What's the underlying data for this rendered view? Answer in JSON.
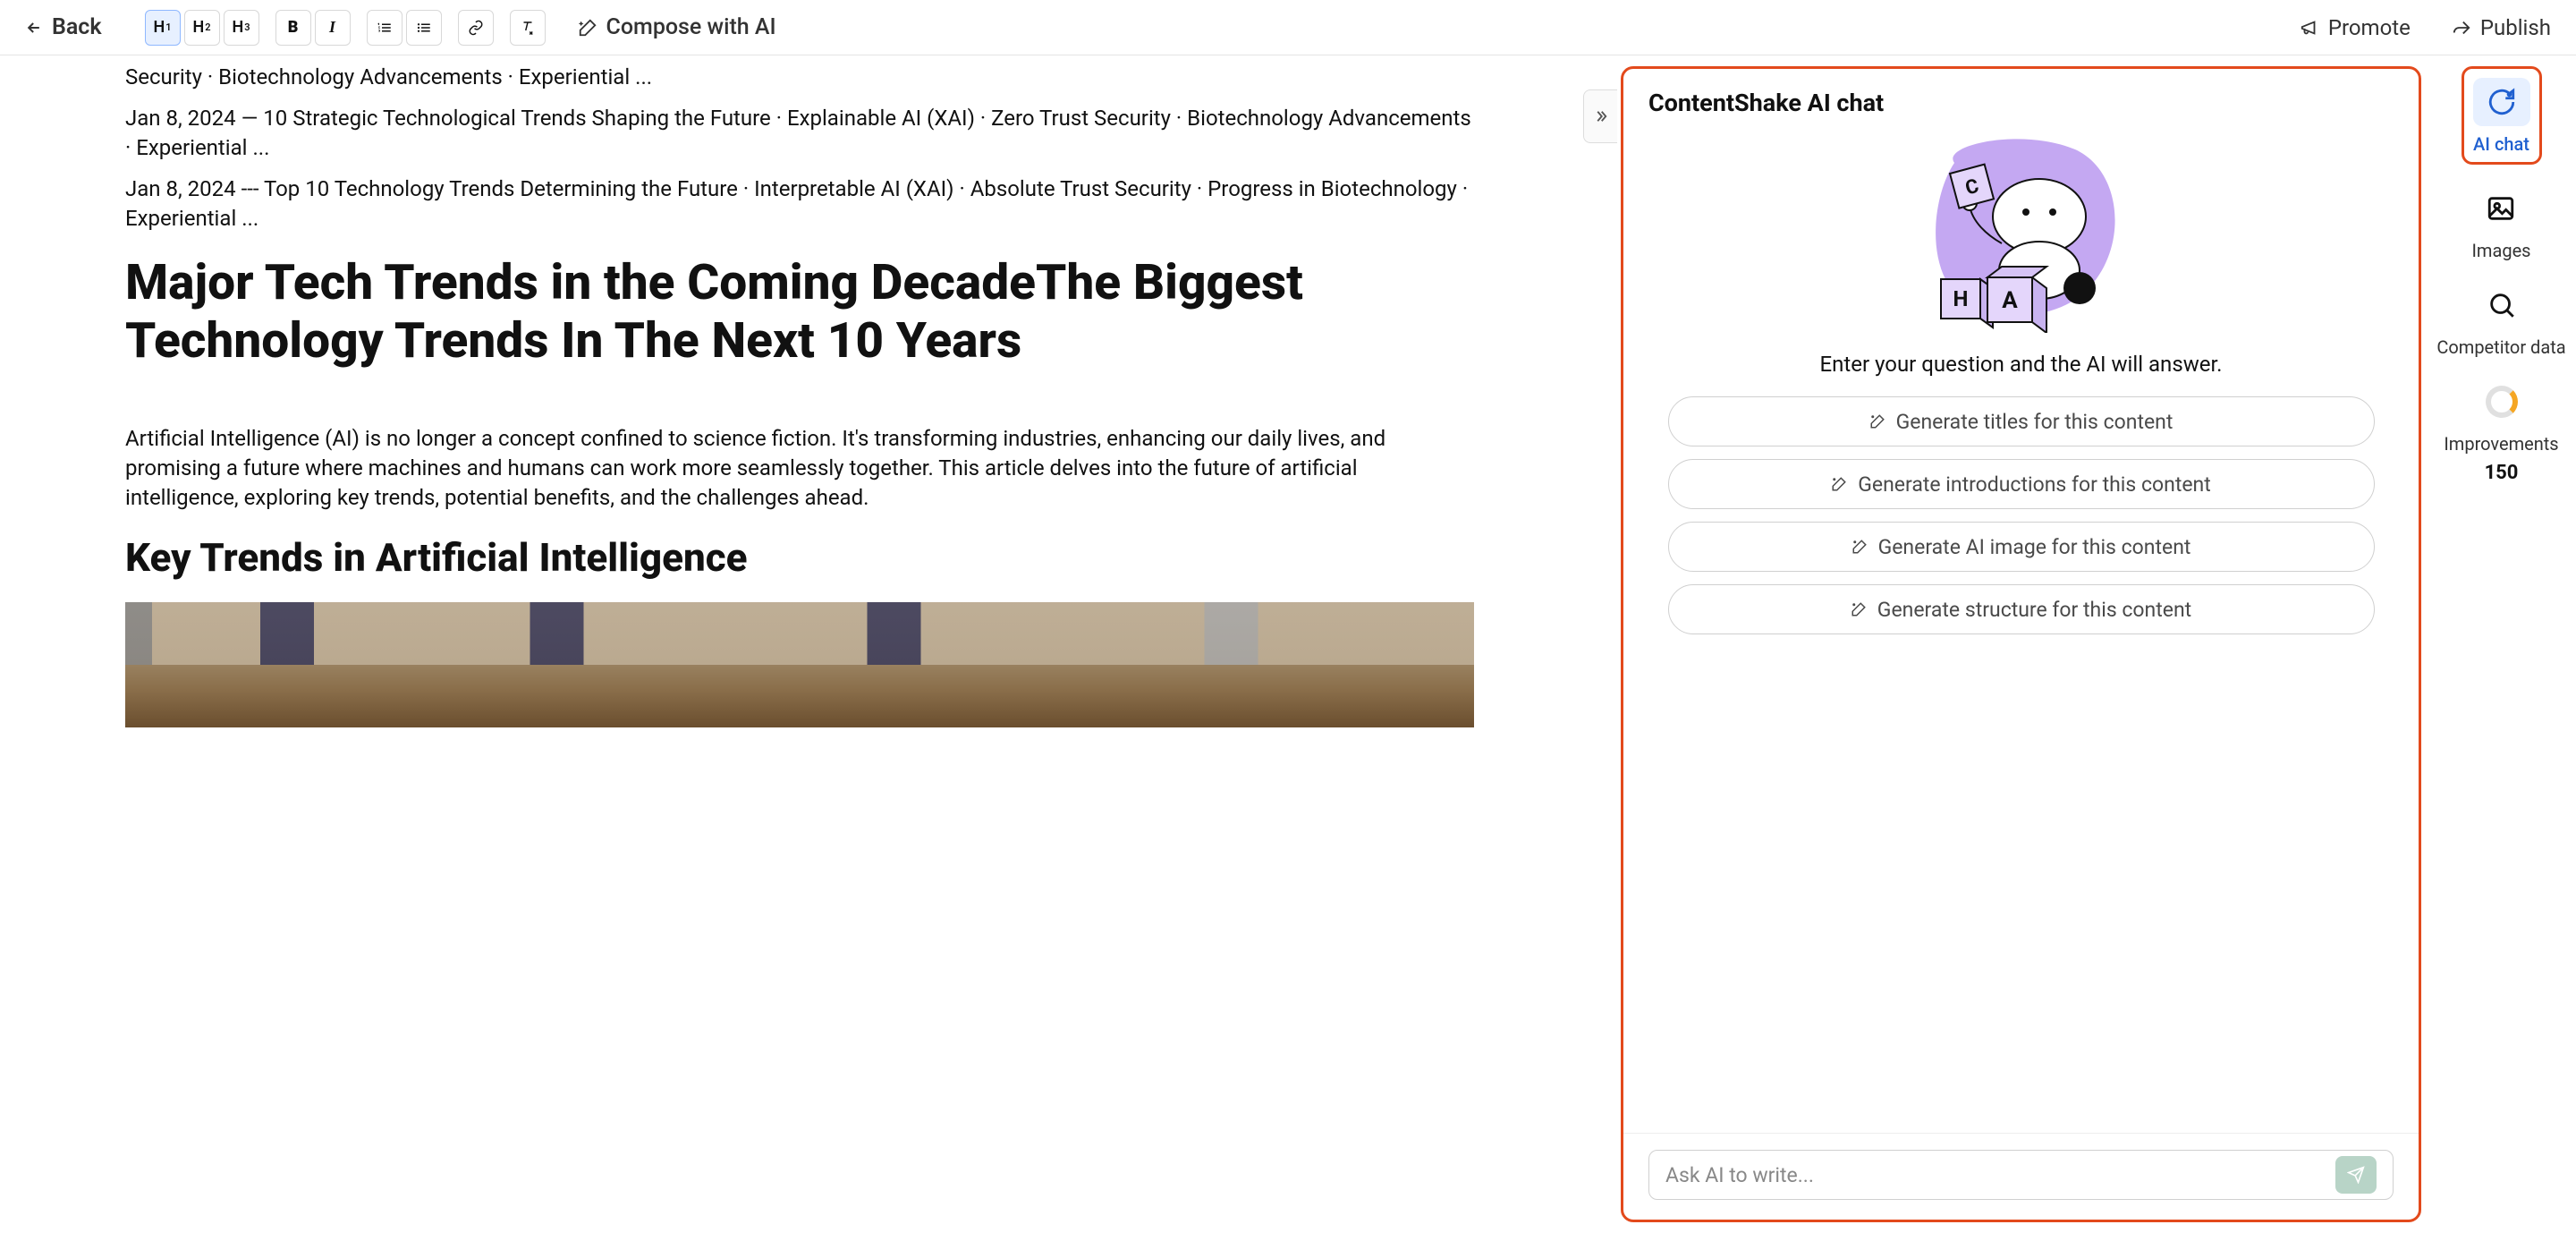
{
  "toolbar": {
    "back": "Back",
    "compose": "Compose with AI",
    "promote": "Promote",
    "publish": "Publish"
  },
  "editor": {
    "snippets": [
      "Security · Biotechnology Advancements · Experiential ...",
      "Jan 8, 2024 — 10 Strategic Technological Trends Shaping the Future · Explainable AI (XAI) · Zero Trust Security · Biotechnology Advancements · Experiential ...",
      "Jan 8, 2024 --- Top 10 Technology Trends Determining the Future · Interpretable AI (XAI) · Absolute Trust Security · Progress in Biotechnology · Experiential ..."
    ],
    "h1": "Major Tech Trends in the Coming DecadeThe Biggest Technology Trends In The Next 10 Years",
    "intro": "Artificial Intelligence (AI) is no longer a concept confined to science fiction. It's transforming industries, enhancing our daily lives, and promising a future where machines and humans can work more seamlessly together. This article delves into the future of artificial intelligence, exploring key trends, potential benefits, and the challenges ahead.",
    "h2": "Key Trends in Artificial Intelligence"
  },
  "chat": {
    "title": "ContentShake AI chat",
    "subtitle": "Enter your question and the AI will answer.",
    "suggestions": [
      "Generate titles for this content",
      "Generate introductions for this content",
      "Generate AI image for this content",
      "Generate structure for this content"
    ],
    "placeholder": "Ask AI to write..."
  },
  "rail": {
    "ai_chat": "AI chat",
    "images": "Images",
    "competitor": "Competitor data",
    "improvements": "Improvements",
    "improvements_count": "150"
  }
}
